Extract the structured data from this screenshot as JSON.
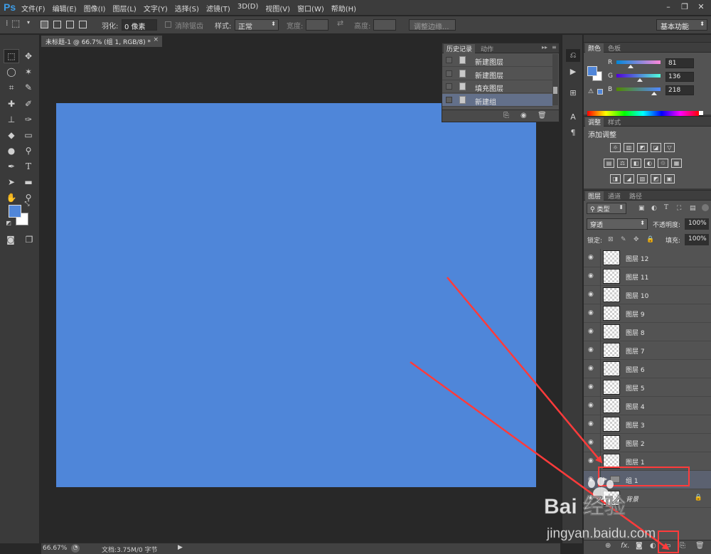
{
  "app": {
    "logo": "Ps",
    "menu": [
      "文件(F)",
      "编辑(E)",
      "图像(I)",
      "图层(L)",
      "文字(Y)",
      "选择(S)",
      "滤镜(T)",
      "3D(D)",
      "视图(V)",
      "窗口(W)",
      "帮助(H)"
    ],
    "window_controls": [
      "–",
      "❐",
      "✕"
    ]
  },
  "options_bar": {
    "feather_label": "羽化:",
    "feather_value": "0 像素",
    "antialias_label": "消除锯齿",
    "style_label": "样式:",
    "style_value": "正常",
    "width_label": "宽度:",
    "height_label": "高度:",
    "refine_edge": "调整边缘...",
    "workspace": "基本功能"
  },
  "document": {
    "tab_title": "未标题-1 @ 66.7% (组 1, RGB/8) *",
    "canvas_color": "#4f86d9"
  },
  "status_bar": {
    "zoom": "66.67%",
    "doc_info": "文档:3.75M/0 字节"
  },
  "history_panel": {
    "tabs": [
      "历史记录",
      "动作"
    ],
    "items": [
      {
        "label": "新建图层",
        "selected": false
      },
      {
        "label": "新建图层",
        "selected": false
      },
      {
        "label": "填充图层",
        "selected": false
      },
      {
        "label": "新建组",
        "selected": true
      }
    ]
  },
  "color_panel": {
    "tabs": [
      "颜色",
      "色板"
    ],
    "foreground": "#5086d9",
    "sliders": [
      {
        "label": "R",
        "value": "81",
        "level": 0.32
      },
      {
        "label": "G",
        "value": "136",
        "level": 0.53
      },
      {
        "label": "B",
        "value": "218",
        "level": 0.85
      }
    ]
  },
  "adjustments_panel": {
    "tabs": [
      "调整",
      "样式"
    ],
    "title": "添加调整",
    "rows": [
      [
        "☼",
        "▥",
        "◩",
        "◪",
        "▽"
      ],
      [
        "▤",
        "⚖",
        "◧",
        "◐",
        "♲",
        "▦"
      ],
      [
        "◨",
        "◢",
        "▧",
        "◩",
        "▣"
      ]
    ]
  },
  "layers_panel": {
    "tabs": [
      "图层",
      "通道",
      "路径"
    ],
    "filter_type": "类型",
    "blend_mode": "穿透",
    "opacity_label": "不透明度:",
    "opacity_value": "100%",
    "lock_label": "锁定:",
    "fill_label": "填充:",
    "fill_value": "100%",
    "layers": [
      {
        "name": "图层 12",
        "kind": "pixel"
      },
      {
        "name": "图层 11",
        "kind": "pixel"
      },
      {
        "name": "图层 10",
        "kind": "pixel"
      },
      {
        "name": "图层 9",
        "kind": "pixel"
      },
      {
        "name": "图层 8",
        "kind": "pixel"
      },
      {
        "name": "图层 7",
        "kind": "pixel"
      },
      {
        "name": "图层 6",
        "kind": "pixel"
      },
      {
        "name": "图层 5",
        "kind": "pixel"
      },
      {
        "name": "图层 4",
        "kind": "pixel"
      },
      {
        "name": "图层 3",
        "kind": "pixel"
      },
      {
        "name": "图层 2",
        "kind": "pixel"
      },
      {
        "name": "图层 1",
        "kind": "pixel"
      },
      {
        "name": "组 1",
        "kind": "group",
        "selected": true
      },
      {
        "name": "背景",
        "kind": "background",
        "locked": true
      }
    ],
    "footer_icons": [
      "link-icon",
      "fx-icon",
      "mask-icon",
      "adjustment-icon",
      "new-group-icon",
      "new-layer-icon",
      "trash-icon"
    ]
  },
  "watermark": {
    "logo_text": "Bai 经验",
    "url": "jingyan.baidu.com"
  },
  "annotation_color": "#ff3b3b"
}
